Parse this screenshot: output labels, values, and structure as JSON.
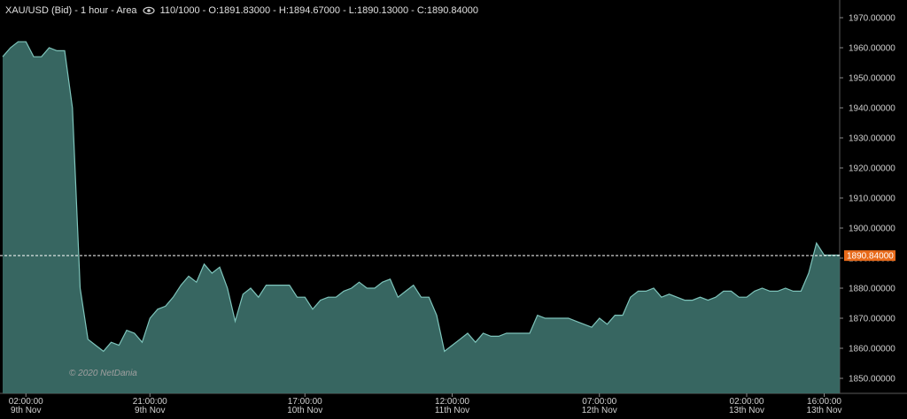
{
  "header": {
    "instrument": "XAU/USD (Bid) - 1 hour - Area",
    "eye_icon": "eye-icon",
    "ohlc": "110/1000 - O:1891.83000 - H:1894.67000 - L:1890.13000 - C:1890.84000"
  },
  "watermark": "© 2020 NetDania",
  "colors": {
    "background": "#000000",
    "area_fill": "#3a6b66",
    "area_line": "#7ec4bb",
    "grid": "#5a5a5a",
    "last_price_tag": "#e86a1a"
  },
  "chart_data": {
    "type": "area",
    "title": "XAU/USD (Bid) - 1 hour - Area",
    "ylim": [
      1845,
      1975
    ],
    "y_ticks": [
      "1970.00000",
      "1960.00000",
      "1950.00000",
      "1940.00000",
      "1930.00000",
      "1920.00000",
      "1910.00000",
      "1900.00000",
      "1890.00000",
      "1880.00000",
      "1870.00000",
      "1860.00000",
      "1850.00000"
    ],
    "y_tick_values": [
      1970,
      1960,
      1950,
      1940,
      1930,
      1920,
      1910,
      1900,
      1890,
      1880,
      1870,
      1860,
      1850
    ],
    "x_ticks": [
      {
        "time": "02:00:00",
        "date": "9th Nov",
        "index": 3
      },
      {
        "time": "21:00:00",
        "date": "9th Nov",
        "index": 19
      },
      {
        "time": "17:00:00",
        "date": "10th Nov",
        "index": 39
      },
      {
        "time": "12:00:00",
        "date": "11th Nov",
        "index": 58
      },
      {
        "time": "07:00:00",
        "date": "12th Nov",
        "index": 77
      },
      {
        "time": "02:00:00",
        "date": "13th Nov",
        "index": 96
      },
      {
        "time": "16:00:00",
        "date": "13th Nov",
        "index": 106
      }
    ],
    "last_price": "1890.84000",
    "last_value": 1890.84,
    "values": [
      1957,
      1960,
      1962,
      1962,
      1957,
      1957,
      1960,
      1959,
      1959,
      1940,
      1880,
      1863,
      1861,
      1859,
      1862,
      1861,
      1866,
      1865,
      1862,
      1870,
      1873,
      1874,
      1877,
      1881,
      1884,
      1882,
      1888,
      1885,
      1887,
      1880,
      1869,
      1878,
      1880,
      1877,
      1881,
      1881,
      1881,
      1881,
      1877,
      1877,
      1873,
      1876,
      1877,
      1877,
      1879,
      1880,
      1882,
      1880,
      1880,
      1882,
      1883,
      1877,
      1879,
      1881,
      1877,
      1877,
      1871,
      1859,
      1861,
      1863,
      1865,
      1862,
      1865,
      1864,
      1864,
      1865,
      1865,
      1865,
      1865,
      1871,
      1870,
      1870,
      1870,
      1870,
      1869,
      1868,
      1867,
      1870,
      1868,
      1871,
      1871,
      1877,
      1879,
      1879,
      1880,
      1877,
      1878,
      1877,
      1876,
      1876,
      1877,
      1876,
      1877,
      1879,
      1879,
      1877,
      1877,
      1879,
      1880,
      1879,
      1879,
      1880,
      1879,
      1879,
      1885,
      1895,
      1891,
      1891,
      1891
    ]
  }
}
